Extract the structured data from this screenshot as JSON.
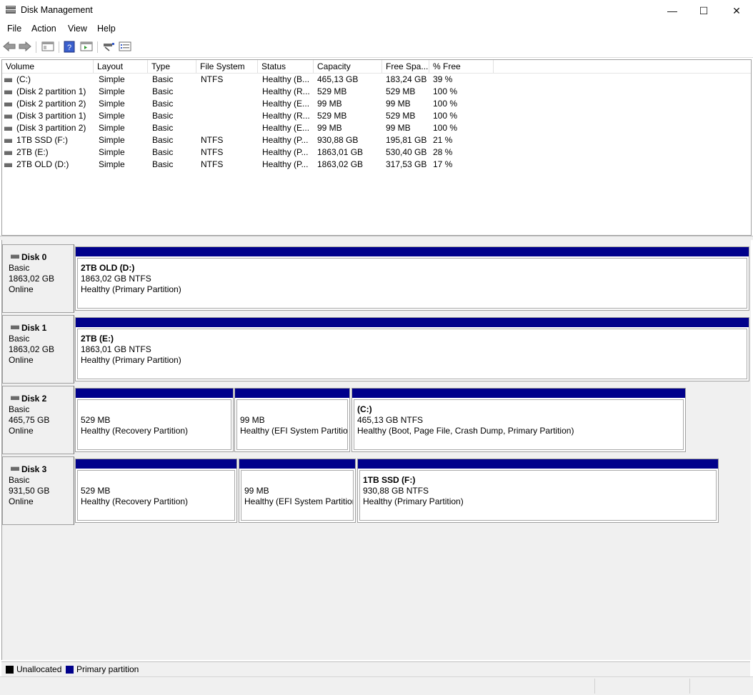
{
  "window": {
    "title": "Disk Management",
    "minimize": "—",
    "maximize": "☐",
    "close": "✕"
  },
  "menu": [
    "File",
    "Action",
    "View",
    "Help"
  ],
  "table": {
    "headers": [
      "Volume",
      "Layout",
      "Type",
      "File System",
      "Status",
      "Capacity",
      "Free Spa...",
      "% Free"
    ],
    "rows": [
      [
        "(C:)",
        "Simple",
        "Basic",
        "NTFS",
        "Healthy (B...",
        "465,13 GB",
        "183,24 GB",
        "39 %"
      ],
      [
        "(Disk 2 partition 1)",
        "Simple",
        "Basic",
        "",
        "Healthy (R...",
        "529 MB",
        "529 MB",
        "100 %"
      ],
      [
        "(Disk 2 partition 2)",
        "Simple",
        "Basic",
        "",
        "Healthy (E...",
        "99 MB",
        "99 MB",
        "100 %"
      ],
      [
        "(Disk 3 partition 1)",
        "Simple",
        "Basic",
        "",
        "Healthy (R...",
        "529 MB",
        "529 MB",
        "100 %"
      ],
      [
        "(Disk 3 partition 2)",
        "Simple",
        "Basic",
        "",
        "Healthy (E...",
        "99 MB",
        "99 MB",
        "100 %"
      ],
      [
        "1TB SSD (F:)",
        "Simple",
        "Basic",
        "NTFS",
        "Healthy (P...",
        "930,88 GB",
        "195,81 GB",
        "21 %"
      ],
      [
        "2TB (E:)",
        "Simple",
        "Basic",
        "NTFS",
        "Healthy (P...",
        "1863,01 GB",
        "530,40 GB",
        "28 %"
      ],
      [
        "2TB OLD (D:)",
        "Simple",
        "Basic",
        "NTFS",
        "Healthy (P...",
        "1863,02 GB",
        "317,53 GB",
        "17 %"
      ]
    ]
  },
  "disks": [
    {
      "name": "Disk 0",
      "type": "Basic",
      "size": "1863,02 GB",
      "state": "Online",
      "partitions": [
        {
          "title": "2TB OLD  (D:)",
          "size": "1863,02 GB NTFS",
          "status": "Healthy (Primary Partition)"
        }
      ]
    },
    {
      "name": "Disk 1",
      "type": "Basic",
      "size": "1863,02 GB",
      "state": "Online",
      "partitions": [
        {
          "title": "2TB  (E:)",
          "size": "1863,01 GB NTFS",
          "status": "Healthy (Primary Partition)"
        }
      ]
    },
    {
      "name": "Disk 2",
      "type": "Basic",
      "size": "465,75 GB",
      "state": "Online",
      "partitions": [
        {
          "title": "",
          "size": "529 MB",
          "status": "Healthy (Recovery Partition)"
        },
        {
          "title": "",
          "size": "99 MB",
          "status": "Healthy (EFI System Partition)"
        },
        {
          "title": "(C:)",
          "size": "465,13 GB NTFS",
          "status": "Healthy (Boot, Page File, Crash Dump, Primary Partition)"
        }
      ]
    },
    {
      "name": "Disk 3",
      "type": "Basic",
      "size": "931,50 GB",
      "state": "Online",
      "partitions": [
        {
          "title": "",
          "size": "529 MB",
          "status": "Healthy (Recovery Partition)"
        },
        {
          "title": "",
          "size": "99 MB",
          "status": "Healthy (EFI System Partition)"
        },
        {
          "title": "1TB SSD  (F:)",
          "size": "930,88 GB NTFS",
          "status": "Healthy (Primary Partition)"
        }
      ]
    }
  ],
  "legend": {
    "unallocated": {
      "label": "Unallocated",
      "color": "#000000"
    },
    "primary": {
      "label": "Primary partition",
      "color": "#00008b"
    }
  },
  "colors": {
    "partition_bar": "#00008b"
  }
}
